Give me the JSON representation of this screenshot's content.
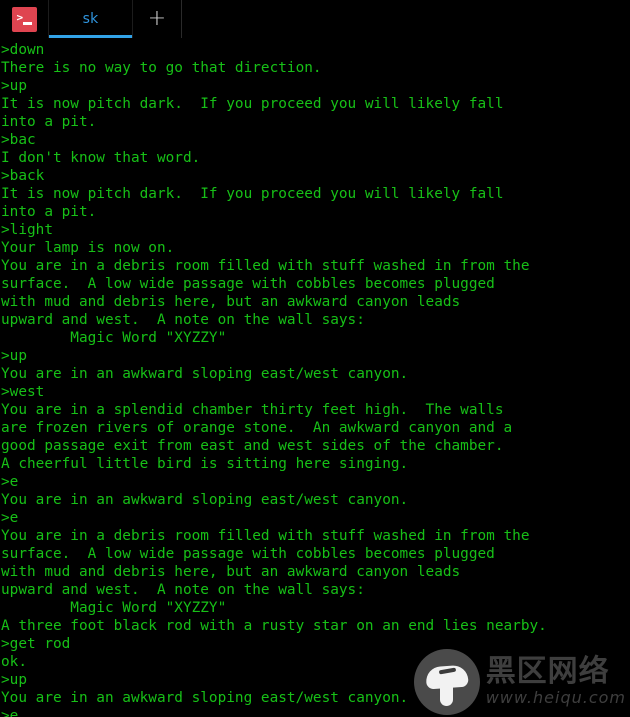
{
  "window": {
    "app_icon": "terminal-prompt-icon",
    "icon_prompt_glyph": ">",
    "accent_color": "#32a3e8",
    "icon_color": "#df4450",
    "text_color": "#17c017",
    "background_color": "#000000"
  },
  "tabbar": {
    "tabs": [
      {
        "label": "sk",
        "active": true
      }
    ],
    "new_tab_label": "+"
  },
  "terminal": {
    "prompt_symbol": ">",
    "lines": [
      ">down",
      "There is no way to go that direction.",
      ">up",
      "It is now pitch dark.  If you proceed you will likely fall",
      "into a pit.",
      ">bac",
      "I don't know that word.",
      ">back",
      "It is now pitch dark.  If you proceed you will likely fall",
      "into a pit.",
      ">light",
      "Your lamp is now on.",
      "You are in a debris room filled with stuff washed in from the",
      "surface.  A low wide passage with cobbles becomes plugged",
      "with mud and debris here, but an awkward canyon leads",
      "upward and west.  A note on the wall says:",
      "        Magic Word \"XYZZY\"",
      ">up",
      "You are in an awkward sloping east/west canyon.",
      ">west",
      "You are in a splendid chamber thirty feet high.  The walls",
      "are frozen rivers of orange stone.  An awkward canyon and a",
      "good passage exit from east and west sides of the chamber.",
      "A cheerful little bird is sitting here singing.",
      ">e",
      "You are in an awkward sloping east/west canyon.",
      ">e",
      "You are in a debris room filled with stuff washed in from the",
      "surface.  A low wide passage with cobbles becomes plugged",
      "with mud and debris here, but an awkward canyon leads",
      "upward and west.  A note on the wall says:",
      "        Magic Word \"XYZZY\"",
      "A three foot black rod with a rusty star on an end lies nearby.",
      ">get rod",
      "ok.",
      ">up",
      "You are in an awkward sloping east/west canyon.",
      ">e"
    ]
  },
  "watermark": {
    "logo": "mushroom-icon",
    "site_name_cn": "黑区网络",
    "site_url": "www.heiqu.com",
    "color": "#3e3e3e"
  }
}
